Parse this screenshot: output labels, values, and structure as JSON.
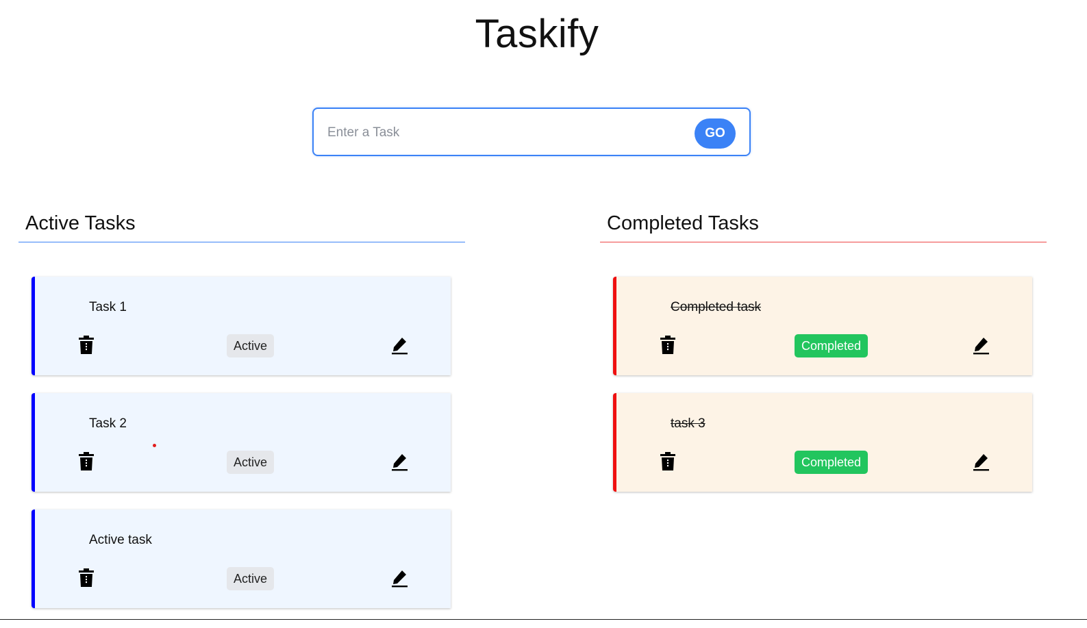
{
  "app": {
    "title": "Taskify"
  },
  "form": {
    "placeholder": "Enter a Task",
    "value": "",
    "submit_label": "GO"
  },
  "columns": {
    "active": {
      "heading": "Active Tasks",
      "tasks": [
        {
          "title": "Task 1",
          "status": "Active"
        },
        {
          "title": "Task 2",
          "status": "Active"
        },
        {
          "title": "Active task",
          "status": "Active"
        }
      ]
    },
    "completed": {
      "heading": "Completed Tasks",
      "tasks": [
        {
          "title": "Completed task",
          "status": "Completed"
        },
        {
          "title": "task 3",
          "status": "Completed"
        }
      ]
    }
  },
  "icons": {
    "delete": "trash-icon",
    "edit": "pencil-icon"
  },
  "colors": {
    "accent": "#3b82f6",
    "active_border": "#0000ff",
    "completed_border": "#ef1010",
    "active_card_bg": "#eff6ff",
    "completed_card_bg": "#fdf3e6",
    "completed_badge": "#22c55e",
    "active_badge": "#e5e7eb"
  }
}
